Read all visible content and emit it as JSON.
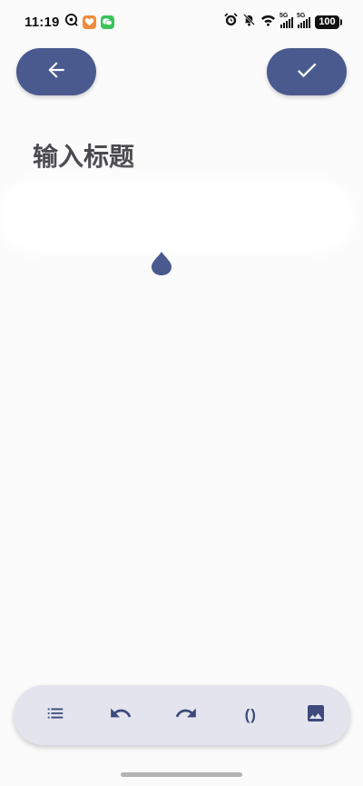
{
  "status_bar": {
    "time": "11:19",
    "network_1": "5G",
    "network_2": "5G",
    "battery": "100",
    "icons": [
      "sync-icon",
      "heart-app-icon",
      "wechat-icon",
      "alarm-icon",
      "mute-icon",
      "wifi-icon",
      "signal-icon",
      "signal-icon",
      "battery-icon"
    ]
  },
  "colors": {
    "accent": "#4a5a8f",
    "toolbar_bg": "#e3e4ee",
    "toolbar_icon": "#3d4a7a",
    "background": "#fbfbfb"
  },
  "header": {
    "back_icon": "arrow-left-icon",
    "done_icon": "check-icon"
  },
  "editor": {
    "title_placeholder": "输入标题",
    "body_value": ""
  },
  "toolbar": {
    "items": [
      {
        "icon": "list-icon"
      },
      {
        "icon": "undo-icon"
      },
      {
        "icon": "redo-icon"
      },
      {
        "icon": "parentheses-icon",
        "label": "()"
      },
      {
        "icon": "image-icon"
      }
    ]
  }
}
